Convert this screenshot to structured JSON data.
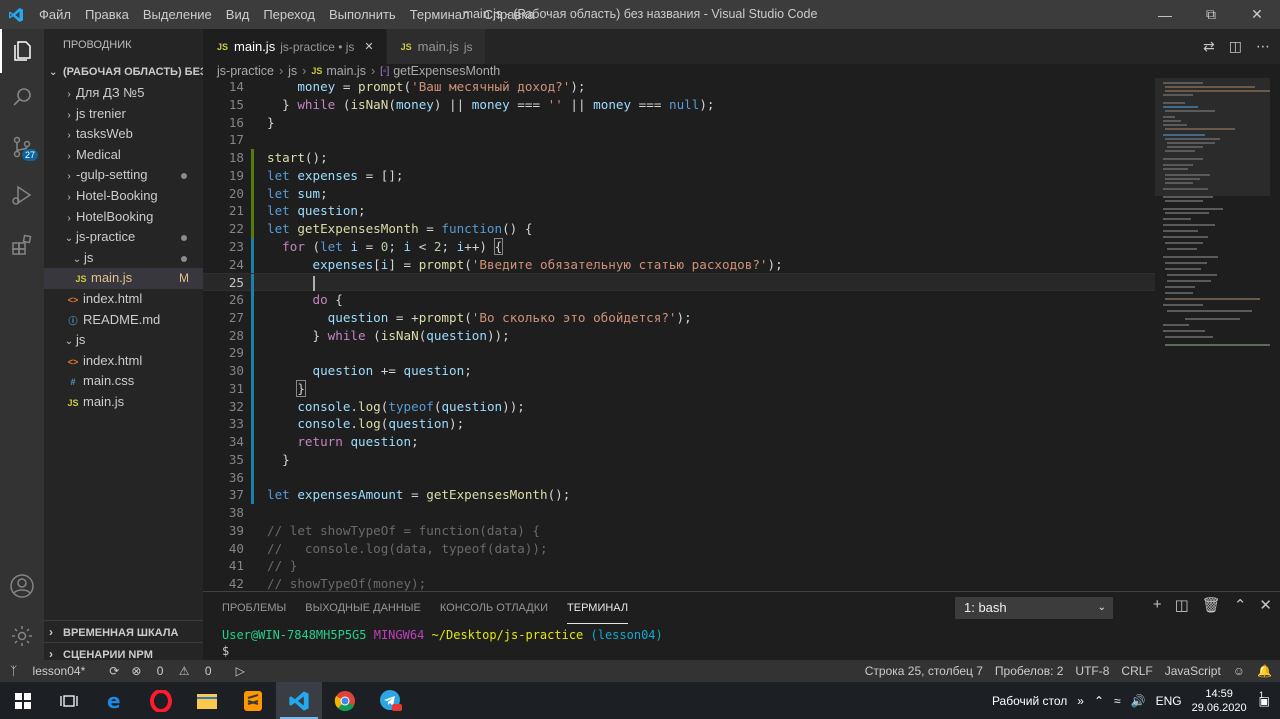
{
  "titlebar": {
    "menu": [
      "Файл",
      "Правка",
      "Выделение",
      "Вид",
      "Переход",
      "Выполнить",
      "Терминал",
      "Справка"
    ],
    "title": "main.js - (Рабочая область) без названия - Visual Studio Code"
  },
  "activity": {
    "badge": "27"
  },
  "sidebar": {
    "title": "ПРОВОДНИК",
    "workspace": "(РАБОЧАЯ ОБЛАСТЬ) БЕЗ ...",
    "items": [
      {
        "label": "Для ДЗ №5"
      },
      {
        "label": "js trenier"
      },
      {
        "label": "tasksWeb"
      },
      {
        "label": "Medical"
      },
      {
        "label": "-gulp-setting"
      },
      {
        "label": "Hotel-Booking"
      },
      {
        "label": "HotelBooking"
      },
      {
        "label": "js-practice"
      },
      {
        "label": "js"
      },
      {
        "label": "main.js",
        "badge": "M"
      },
      {
        "label": "index.html"
      },
      {
        "label": "README.md"
      },
      {
        "label": "js"
      },
      {
        "label": "index.html"
      },
      {
        "label": "main.css"
      },
      {
        "label": "main.js"
      }
    ],
    "timeline": "ВРЕМЕННАЯ ШКАЛА",
    "npm": "СЦЕНАРИИ NPM"
  },
  "tabs": [
    {
      "icon": "JS",
      "label": "main.js",
      "desc": "js-practice • js"
    },
    {
      "icon": "JS",
      "label": "main.js",
      "desc": "js"
    }
  ],
  "breadcrumb": [
    "js-practice",
    "js",
    "main.js",
    "getExpensesMonth"
  ],
  "code": {
    "line_numbers": [
      "14",
      "15",
      "16",
      "17",
      "18",
      "19",
      "20",
      "21",
      "22",
      "23",
      "24",
      "25",
      "26",
      "27",
      "28",
      "29",
      "30",
      "31",
      "32",
      "33",
      "34",
      "35",
      "36",
      "37",
      "38",
      "39",
      "40",
      "41",
      "42"
    ]
  },
  "panel": {
    "tabs": [
      "ПРОБЛЕМЫ",
      "ВЫХОДНЫЕ ДАННЫЕ",
      "КОНСОЛЬ ОТЛАДКИ",
      "ТЕРМИНАЛ"
    ],
    "terminal_select": "1: bash",
    "prompt_user": "User@WIN-7848MH5P5G5",
    "prompt_env": "MINGW64",
    "prompt_path": "~/Desktop/js-practice",
    "prompt_branch": "(lesson04)",
    "prompt_symbol": "$"
  },
  "statusbar": {
    "branch": "lesson04*",
    "errors": "0",
    "warnings": "0",
    "position": "Строка 25, столбец 7",
    "spaces": "Пробелов: 2",
    "encoding": "UTF-8",
    "eol": "CRLF",
    "language": "JavaScript"
  },
  "taskbar": {
    "desktop_label": "Рабочий стол",
    "lang": "ENG",
    "time": "14:59",
    "date": "29.06.2020",
    "notif": "1"
  },
  "colors": {
    "accent": "#007acc",
    "titlebar": "#3c3c3c",
    "sidebar": "#252526",
    "editor": "#1e1e1e",
    "statusbar": "#333333"
  }
}
